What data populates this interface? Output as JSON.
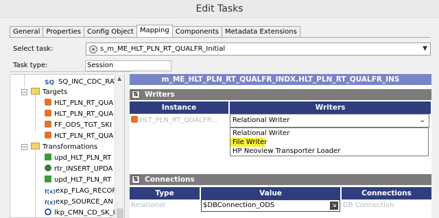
{
  "window": {
    "title": "Edit Tasks"
  },
  "tabs": [
    "General",
    "Properties",
    "Config Object",
    "Mapping",
    "Components",
    "Metadata Extensions"
  ],
  "active_tab": "Mapping",
  "form": {
    "select_task_label": "Select task:",
    "select_task_value": "s_m_ME_HLT_PLN_RT_QUALFR_Initial",
    "task_type_label": "Task type:",
    "task_type_value": "Session"
  },
  "tree": {
    "items": [
      {
        "label": "SQ_INC_CDC_RAT",
        "icon": "source-qualifier-icon"
      },
      {
        "label": "Targets",
        "icon": "folder-icon"
      },
      {
        "label": "HLT_PLN_RT_QUA",
        "icon": "target-icon"
      },
      {
        "label": "HLT_PLN_RT_QUA",
        "icon": "target-icon"
      },
      {
        "label": "FF_ODS_TGT_SKI",
        "icon": "target-icon"
      },
      {
        "label": "HLT_PLN_RT_QUA",
        "icon": "target-icon"
      },
      {
        "label": "Transformations",
        "icon": "folder-icon"
      },
      {
        "label": "upd_HLT_PLN_RT",
        "icon": "update-strategy-icon"
      },
      {
        "label": "rtr_INSERT_UPDA",
        "icon": "router-icon"
      },
      {
        "label": "upd_HLT_PLN_RT",
        "icon": "update-strategy-icon"
      },
      {
        "label": "exp_FLAG_RECOR",
        "icon": "expression-icon"
      },
      {
        "label": "exp_SOURCE_AN",
        "icon": "expression-icon"
      },
      {
        "label": "lkp_CMN_CD_SK_I",
        "icon": "lookup-icon"
      }
    ]
  },
  "mapping_header": "m_ME_HLT_PLN_RT_QUALFR_INDX.HLT_PLN_RT_QUALFR_INS",
  "writers": {
    "section_label": "Writers",
    "columns": [
      "Instance",
      "Writers"
    ],
    "row": {
      "instance": "HLT_PLN_RT_QUALFR...",
      "writer": "Relational Writer"
    },
    "options": [
      "Relational Writer",
      "File Writer",
      "HP Neoview Transporter Loader"
    ],
    "highlighted_option": "File Writer"
  },
  "connections": {
    "section_label": "Connections",
    "columns": [
      "Type",
      "Value",
      "Connections"
    ],
    "row": {
      "type": "Relational",
      "value": "$DBConnection_ODS",
      "connection": "DB Connection"
    }
  },
  "colors": {
    "mapping_header_bg": "#7a84c7",
    "section_bg": "#7b7b7b",
    "column_header_bg": "#2f3e7f",
    "highlight": "#f6f034"
  }
}
